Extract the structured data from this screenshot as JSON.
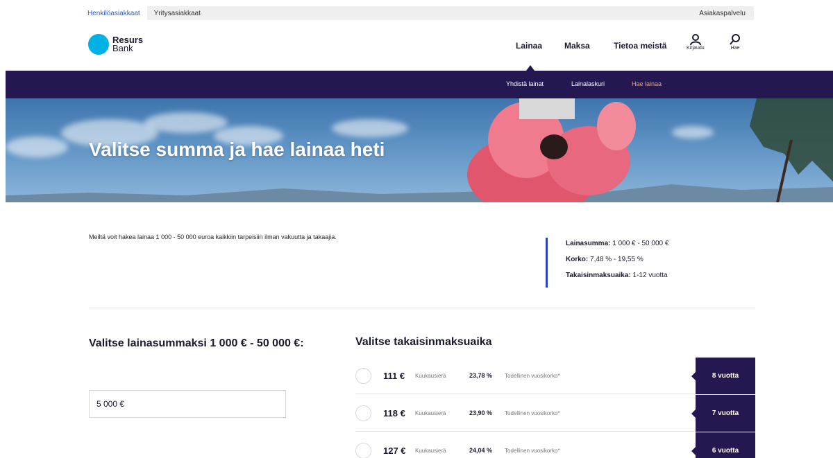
{
  "topbar": {
    "tab_private": "Henkilöasiakkaat",
    "tab_business": "Yritysasiakkaat",
    "customer_service": "Asiakaspalvelu"
  },
  "header": {
    "logo_line1": "Resurs",
    "logo_line2": "Bank",
    "nav": {
      "loans": "Lainaa",
      "pay": "Maksa",
      "about": "Tietoa meistä"
    },
    "login_label": "Kirjaudu",
    "search_label": "Hae"
  },
  "subnav": {
    "combine": "Yhdistä lainat",
    "calculator": "Lainalaskuri",
    "apply": "Hae lainaa"
  },
  "hero": {
    "title": "Valitse summa ja hae lainaa heti"
  },
  "intro": {
    "text": "Meiltä voit hakea lainaa 1 000 - 50 000 euroa kaikkiin tarpeisiin ilman vakuutta ja takaajia."
  },
  "facts": {
    "amount_label": "Lainasumma:",
    "amount_value": " 1 000 € - 50 000 €",
    "rate_label": "Korko:",
    "rate_value": " 7,48 % - 19,55 %",
    "term_label": "Takaisinmaksuaika:",
    "term_value": " 1-12 vuotta"
  },
  "amount": {
    "title": "Valitse lainasummaksi 1 000 € - 50 000 €:",
    "value": "5 000 €"
  },
  "repayment": {
    "title": "Valitse takaisinmaksuaika",
    "options": [
      {
        "monthly": "111 €",
        "monthly_label": "Kuukausierä",
        "apr": "23,78 %",
        "apr_label": "Todellinen vuosikorko*",
        "years": "8 vuotta"
      },
      {
        "monthly": "118 €",
        "monthly_label": "Kuukausierä",
        "apr": "23,90 %",
        "apr_label": "Todellinen vuosikorko*",
        "years": "7 vuotta"
      },
      {
        "monthly": "127 €",
        "monthly_label": "Kuukausierä",
        "apr": "24,04 %",
        "apr_label": "Todellinen vuosikorko*",
        "years": "6 vuotta"
      }
    ]
  },
  "colors": {
    "navy": "#25174f",
    "brand_cyan": "#00b1e6",
    "accent_orange": "#f0a860",
    "link_blue": "#2a5bd7"
  }
}
